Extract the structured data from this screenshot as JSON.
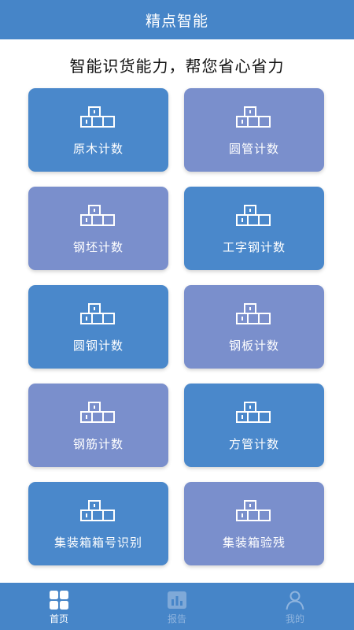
{
  "app": {
    "title": "精点智能"
  },
  "slogan": "智能识货能力，帮您省心省力",
  "cards": [
    {
      "label": "原木计数",
      "icon": "boxes-icon",
      "color": "#4a88cb"
    },
    {
      "label": "圆管计数",
      "icon": "boxes-icon",
      "color": "#7a8fcc"
    },
    {
      "label": "钢坯计数",
      "icon": "boxes-icon",
      "color": "#7a8fcc"
    },
    {
      "label": "工字钢计数",
      "icon": "boxes-icon",
      "color": "#4a88cb"
    },
    {
      "label": "圆钢计数",
      "icon": "boxes-icon",
      "color": "#4a88cb"
    },
    {
      "label": "钢板计数",
      "icon": "boxes-icon",
      "color": "#7a8fcc"
    },
    {
      "label": "钢筋计数",
      "icon": "boxes-icon",
      "color": "#7a8fcc"
    },
    {
      "label": "方管计数",
      "icon": "boxes-icon",
      "color": "#4a88cb"
    },
    {
      "label": "集装箱箱号识别",
      "icon": "boxes-icon",
      "color": "#4a88cb"
    },
    {
      "label": "集装箱验残",
      "icon": "boxes-icon",
      "color": "#7a8fcc"
    }
  ],
  "tabbar": {
    "items": [
      {
        "label": "首页",
        "icon": "grid-icon",
        "active": true
      },
      {
        "label": "报告",
        "icon": "bar-chart-icon",
        "active": false
      },
      {
        "label": "我的",
        "icon": "person-icon",
        "active": false
      }
    ]
  },
  "colors": {
    "header": "#4685c8",
    "card_blue": "#4a88cb",
    "card_purple": "#7a8fcc",
    "tab_active": "#ffffff",
    "tab_inactive": "#8fb4de"
  }
}
